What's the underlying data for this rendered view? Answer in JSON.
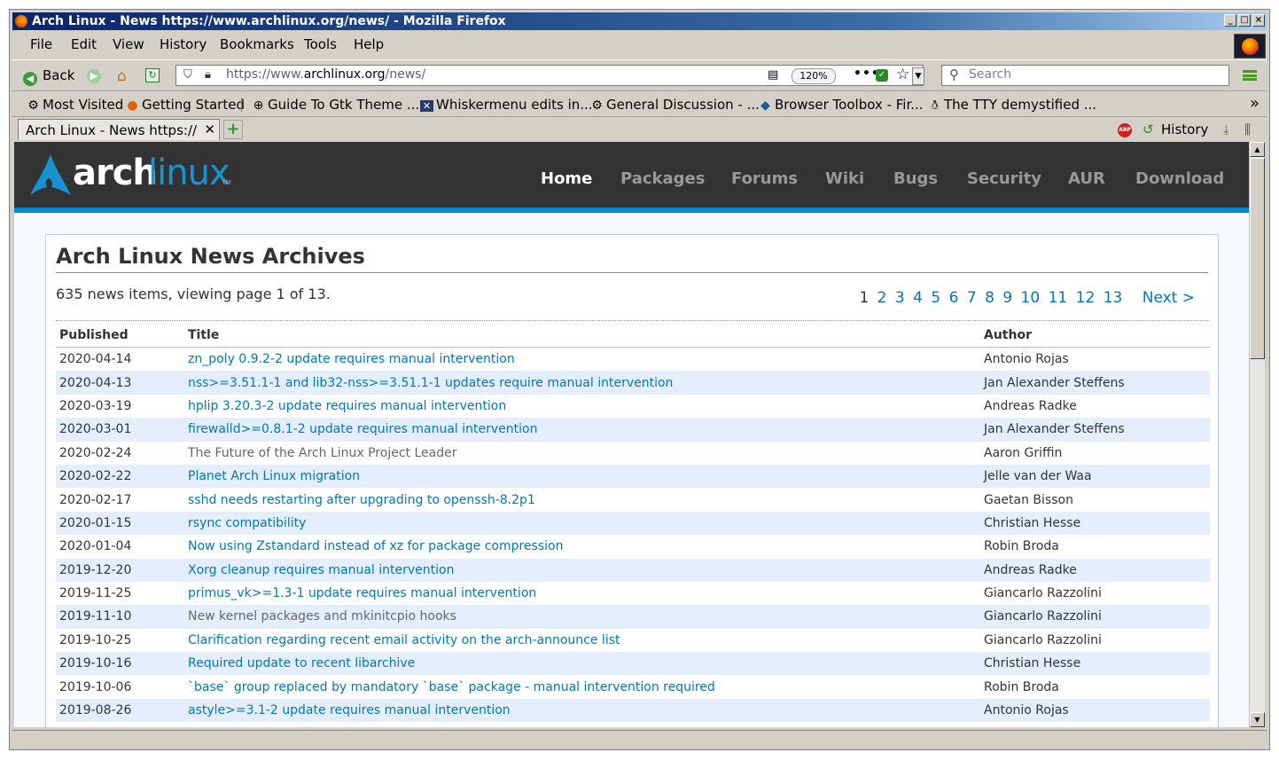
{
  "window": {
    "title": "Arch Linux - News https://www.archlinux.org/news/ - Mozilla Firefox"
  },
  "menu": [
    "File",
    "Edit",
    "View",
    "History",
    "Bookmarks",
    "Tools",
    "Help"
  ],
  "navbar": {
    "back_label": "Back",
    "url_host_prefix": "https://www.",
    "url_host": "archlinux.org",
    "url_path": "/news/",
    "zoom": "120%",
    "search_placeholder": "Search"
  },
  "bookmarks": [
    {
      "label": "Most Visited",
      "icon": "gear-icon"
    },
    {
      "label": "Getting Started",
      "icon": "firefox-icon"
    },
    {
      "label": "Guide To Gtk Theme ...",
      "icon": "globe-icon"
    },
    {
      "label": "Whiskermenu edits in...",
      "icon": "xfce-icon"
    },
    {
      "label": "General Discussion - ...",
      "icon": "gear-icon"
    },
    {
      "label": "Browser Toolbox - Fir...",
      "icon": "mdn-icon"
    },
    {
      "label": "The TTY demystified ...",
      "icon": "tux-icon"
    }
  ],
  "tabs": {
    "active_label": "Arch Linux - News https://www.archlinux.org/news/",
    "history_label": "History"
  },
  "site": {
    "logo_arch": "arch",
    "logo_linux": "linux",
    "logo_tm": "TM",
    "nav": [
      "Home",
      "Packages",
      "Forums",
      "Wiki",
      "Bugs",
      "Security",
      "AUR",
      "Download"
    ],
    "heading": "Arch Linux News Archives",
    "summary": "635 news items, viewing page 1 of 13.",
    "pages": [
      "1",
      "2",
      "3",
      "4",
      "5",
      "6",
      "7",
      "8",
      "9",
      "10",
      "11",
      "12",
      "13"
    ],
    "next_label": "Next >",
    "columns": [
      "Published",
      "Title",
      "Author"
    ],
    "rows": [
      {
        "date": "2020-04-14",
        "title": "zn_poly 0.9.2-2 update requires manual intervention",
        "author": "Antonio Rojas",
        "link": true
      },
      {
        "date": "2020-04-13",
        "title": "nss>=3.51.1-1 and lib32-nss>=3.51.1-1 updates require manual intervention",
        "author": "Jan Alexander Steffens",
        "link": true
      },
      {
        "date": "2020-03-19",
        "title": "hplip 3.20.3-2 update requires manual intervention",
        "author": "Andreas Radke",
        "link": true
      },
      {
        "date": "2020-03-01",
        "title": "firewalld>=0.8.1-2 update requires manual intervention",
        "author": "Jan Alexander Steffens",
        "link": true
      },
      {
        "date": "2020-02-24",
        "title": "The Future of the Arch Linux Project Leader",
        "author": "Aaron Griffin",
        "link": false
      },
      {
        "date": "2020-02-22",
        "title": "Planet Arch Linux migration",
        "author": "Jelle van der Waa",
        "link": true
      },
      {
        "date": "2020-02-17",
        "title": "sshd needs restarting after upgrading to openssh-8.2p1",
        "author": "Gaetan Bisson",
        "link": true
      },
      {
        "date": "2020-01-15",
        "title": "rsync compatibility",
        "author": "Christian Hesse",
        "link": true
      },
      {
        "date": "2020-01-04",
        "title": "Now using Zstandard instead of xz for package compression",
        "author": "Robin Broda",
        "link": true
      },
      {
        "date": "2019-12-20",
        "title": "Xorg cleanup requires manual intervention",
        "author": "Andreas Radke",
        "link": true
      },
      {
        "date": "2019-11-25",
        "title": "primus_vk>=1.3-1 update requires manual intervention",
        "author": "Giancarlo Razzolini",
        "link": true
      },
      {
        "date": "2019-11-10",
        "title": "New kernel packages and mkinitcpio hooks",
        "author": "Giancarlo Razzolini",
        "link": false
      },
      {
        "date": "2019-10-25",
        "title": "Clarification regarding recent email activity on the arch-announce list",
        "author": "Giancarlo Razzolini",
        "link": true
      },
      {
        "date": "2019-10-16",
        "title": "Required update to recent libarchive",
        "author": "Christian Hesse",
        "link": true
      },
      {
        "date": "2019-10-06",
        "title": "`base` group replaced by mandatory `base` package - manual intervention required",
        "author": "Robin Broda",
        "link": true
      },
      {
        "date": "2019-08-26",
        "title": "astyle>=3.1-2 update requires manual intervention",
        "author": "Antonio Rojas",
        "link": true
      }
    ]
  },
  "colors": {
    "arch_blue": "#1793d1",
    "link": "#0077bb",
    "header_bg": "#333333",
    "row_alt": "#e4eeff"
  }
}
